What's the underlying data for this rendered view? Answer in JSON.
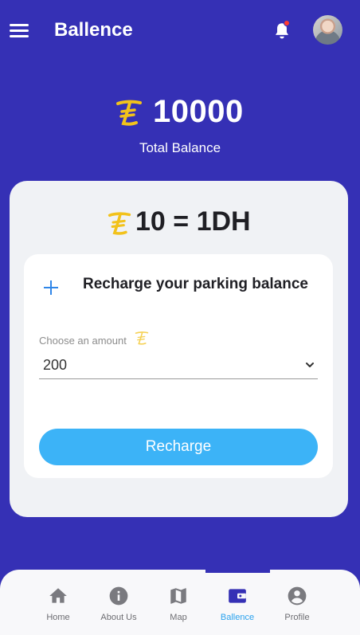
{
  "header": {
    "title": "Ballence",
    "menu_icon": "hamburger-menu-icon",
    "notification_icon": "bell-icon",
    "avatar": "user-avatar"
  },
  "balance": {
    "currency_icon": "coin-currency-icon",
    "amount": "10000",
    "caption": "Total Balance"
  },
  "rate": {
    "currency_icon": "coin-currency-icon",
    "text": "10 = 1DH"
  },
  "recharge_card": {
    "title": "Recharge your parking balance",
    "add_icon": "plus-icon",
    "amount_label": "Choose an amount",
    "amount_value": "200",
    "dropdown_icon": "chevron-down-icon",
    "button_label": "Recharge"
  },
  "bottom_nav": {
    "items": [
      {
        "label": "Home",
        "icon": "home-icon",
        "active": false
      },
      {
        "label": "About Us",
        "icon": "info-icon",
        "active": false
      },
      {
        "label": "Map",
        "icon": "map-icon",
        "active": false
      },
      {
        "label": "Ballence",
        "icon": "wallet-icon",
        "active": true
      },
      {
        "label": "Profile",
        "icon": "profile-icon",
        "active": false
      }
    ]
  },
  "colors": {
    "background": "#3530b5",
    "accent": "#3cb3f7",
    "coin": "#f2c21b",
    "active_nav": "#2aa2ee"
  }
}
